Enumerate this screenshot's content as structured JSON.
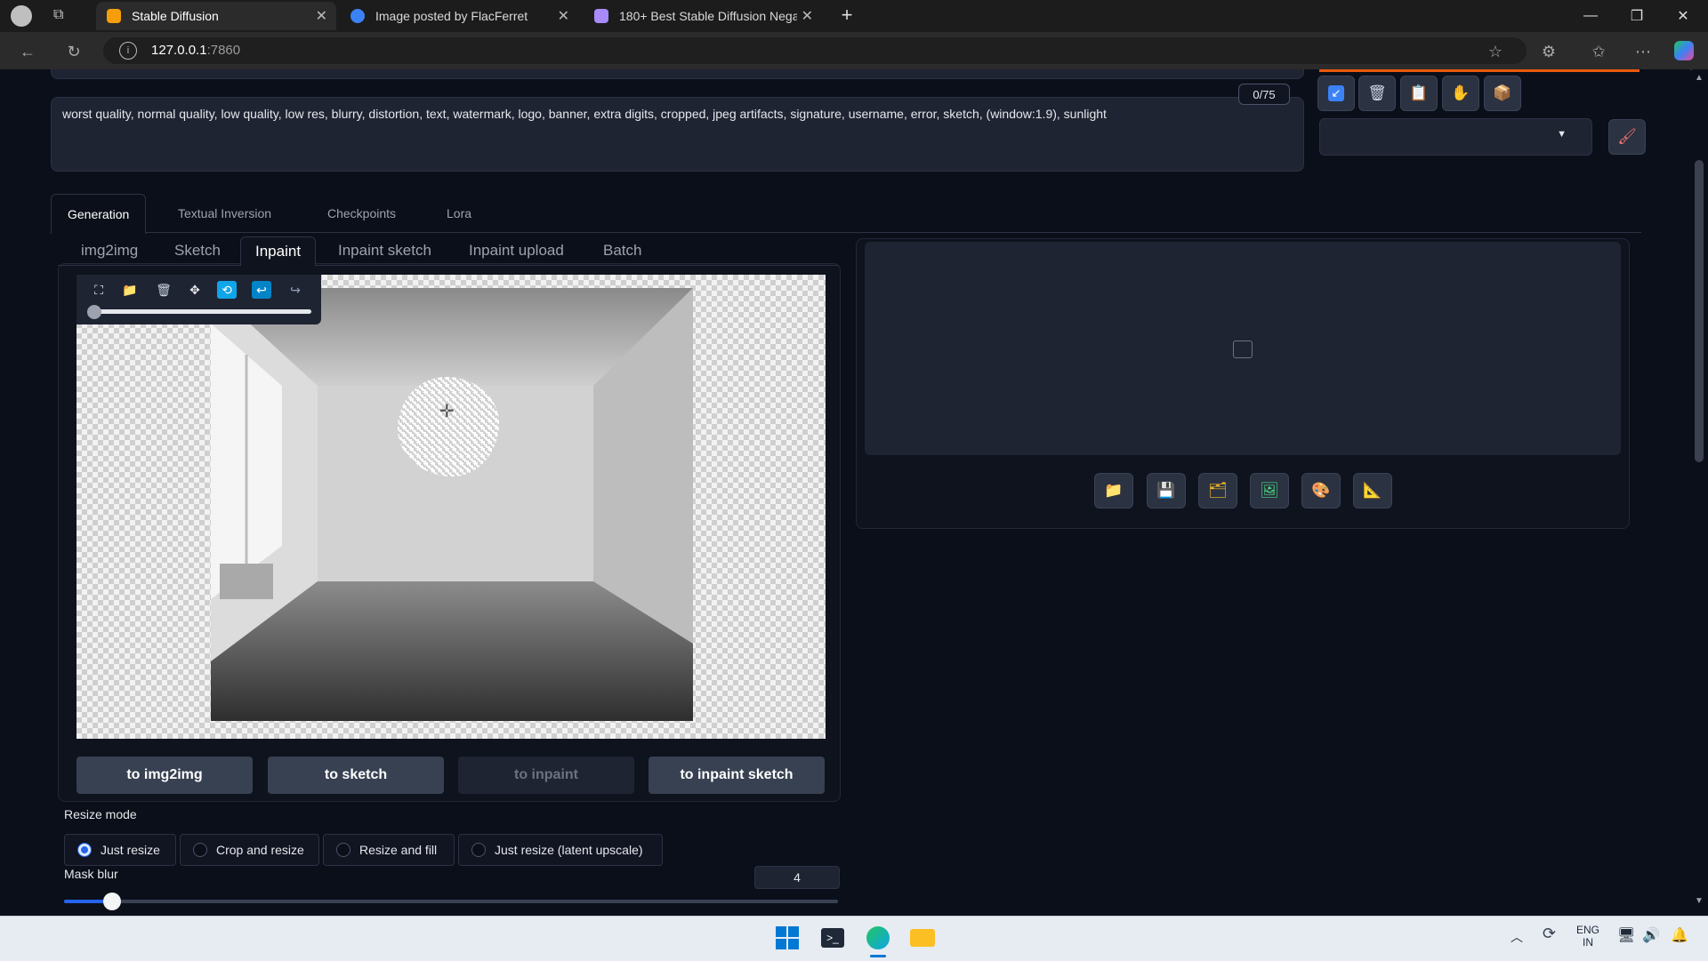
{
  "browser": {
    "tabs": [
      {
        "title": "Stable Diffusion",
        "active": true
      },
      {
        "title": "Image posted by FlacFerret",
        "active": false
      },
      {
        "title": "180+ Best Stable Diffusion Negat",
        "active": false
      }
    ],
    "new_tab_icon": "plus-icon",
    "url_host": "127.0.0.1",
    "url_port": ":7860"
  },
  "prompt": {
    "negative_text": "worst quality, normal quality, low quality, low res, blurry, distortion, text, watermark, logo, banner, extra digits, cropped, jpeg artifacts, signature, username, error, sketch, (window:1.9), sunlight",
    "token_count": "0/75"
  },
  "main_tabs": [
    "Generation",
    "Textual Inversion",
    "Checkpoints",
    "Lora"
  ],
  "sub_tabs": [
    "img2img",
    "Sketch",
    "Inpaint",
    "Inpaint sketch",
    "Inpaint upload",
    "Batch"
  ],
  "send_buttons": [
    "to img2img",
    "to sketch",
    "to inpaint",
    "to inpaint sketch"
  ],
  "resize_mode": {
    "label": "Resize mode",
    "options": [
      "Just resize",
      "Crop and resize",
      "Resize and fill",
      "Just resize (latent upscale)"
    ],
    "selected": "Just resize"
  },
  "mask_blur": {
    "label": "Mask blur",
    "value": "4",
    "fraction": 0.062
  },
  "taskbar": {
    "lang_line1": "ENG",
    "lang_line2": "IN"
  },
  "colors": {
    "accent": "#2563eb",
    "background": "#0b0f19"
  }
}
